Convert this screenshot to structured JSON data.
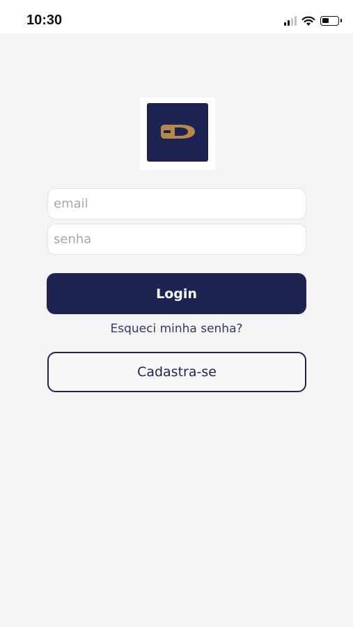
{
  "status_bar": {
    "time": "10:30",
    "icons": [
      "signal-icon",
      "wifi-icon",
      "battery-icon"
    ]
  },
  "logo": {
    "letter": "D",
    "background_color": "#1d2452",
    "letter_color": "#b8874a"
  },
  "form": {
    "email_placeholder": "email",
    "email_value": "",
    "password_placeholder": "senha",
    "password_value": ""
  },
  "actions": {
    "login_label": "Login",
    "forgot_label": "Esqueci minha senha?",
    "signup_label": "Cadastra-se"
  },
  "colors": {
    "primary": "#1d2452",
    "background": "#f4f4f4",
    "accent": "#b8874a"
  }
}
